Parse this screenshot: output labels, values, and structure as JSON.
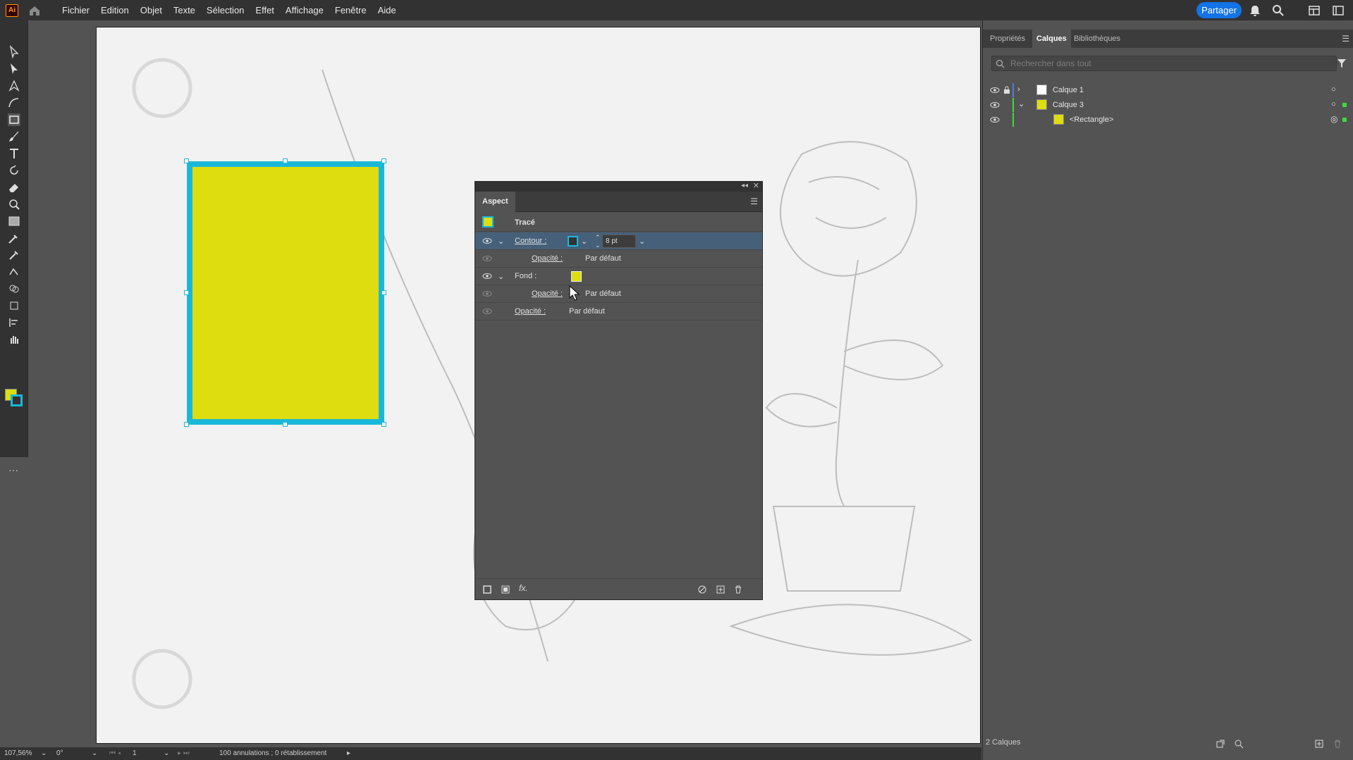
{
  "app": {
    "logo": "Ai"
  },
  "menu": [
    "Fichier",
    "Edition",
    "Objet",
    "Texte",
    "Sélection",
    "Effet",
    "Affichage",
    "Fenêtre",
    "Aide"
  ],
  "share_label": "Partager",
  "colors": {
    "accent": "#1473e6",
    "fill": "#dddd10",
    "stroke": "#1ab8d8",
    "selection_row": "#46607a"
  },
  "aspect": {
    "tab": "Aspect",
    "header_label": "Tracé",
    "stroke_label": "Contour :",
    "stroke_weight": "8 pt",
    "stroke_opacity_label": "Opacité :",
    "stroke_opacity_value": "Par défaut",
    "fill_label": "Fond :",
    "fill_opacity_label": "Opacité :",
    "fill_opacity_value": "Par défaut",
    "opacity_label": "Opacité :",
    "opacity_value": "Par défaut"
  },
  "right_panel": {
    "tabs": [
      "Propriétés",
      "Calques",
      "Bibliothèques"
    ],
    "search_placeholder": "Rechercher dans tout",
    "layers": [
      {
        "name": "Calque 1"
      },
      {
        "name": "Calque 3"
      },
      {
        "name": "<Rectangle>"
      }
    ],
    "count": "2 Calques"
  },
  "status": {
    "zoom": "107,56%",
    "rotation": "0°",
    "artboard": "1",
    "message": "100 annulations ; 0 rétablissement"
  }
}
